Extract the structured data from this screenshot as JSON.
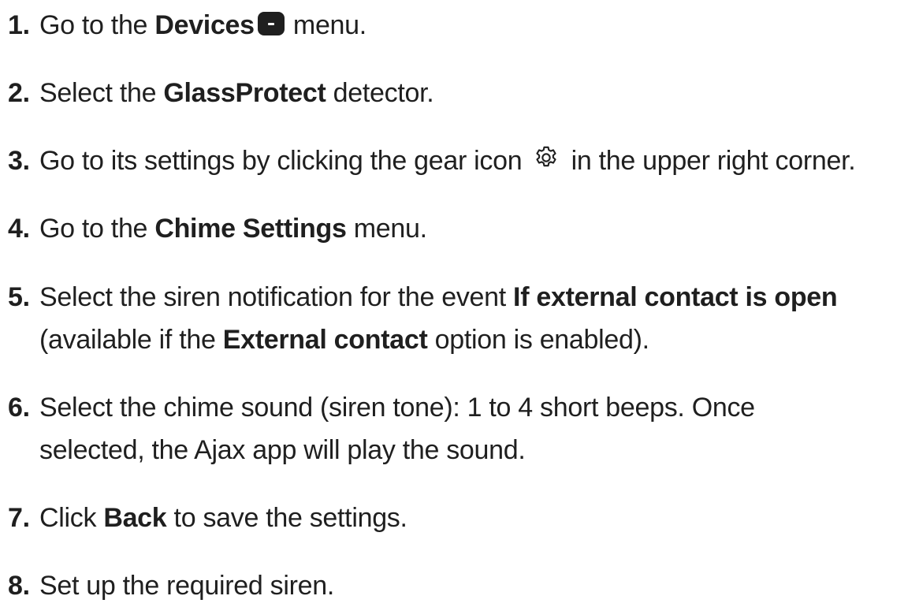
{
  "steps": [
    {
      "num": "1.",
      "pre": "Go to the ",
      "bold": "Devices",
      "icon": "devices-icon",
      "post": " menu."
    },
    {
      "num": "2.",
      "pre": "Select the ",
      "bold": "GlassProtect",
      "post": " detector."
    },
    {
      "num": "3.",
      "pre": "Go to its settings by clicking the gear icon ",
      "icon": "gear-icon",
      "post": " in the upper right corner."
    },
    {
      "num": "4.",
      "pre": "Go to the ",
      "bold": "Chime Settings",
      "post": " menu."
    },
    {
      "num": "5.",
      "pre": "Select the siren notification for the event ",
      "bold": "If external contact is open",
      "line2_pre": "(available if the ",
      "line2_bold": "External contact",
      "line2_post": " option is enabled)."
    },
    {
      "num": "6.",
      "pre": "Select the chime sound (siren tone): 1 to 4 short beeps. Once",
      "line2_pre": "selected, the Ajax app will play the sound."
    },
    {
      "num": "7.",
      "pre": "Click ",
      "bold": "Back",
      "post": " to save the settings."
    },
    {
      "num": "8.",
      "pre": "Set up the required siren."
    }
  ]
}
